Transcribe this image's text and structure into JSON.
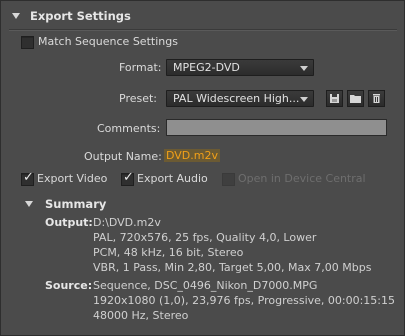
{
  "section": {
    "title": "Export Settings"
  },
  "match_sequence": {
    "label": "Match Sequence Settings",
    "checked": false
  },
  "format": {
    "label": "Format:",
    "value": "MPEG2-DVD"
  },
  "preset": {
    "label": "Preset:",
    "value": "PAL Widescreen High..."
  },
  "comments": {
    "label": "Comments:",
    "value": ""
  },
  "output_name": {
    "label": "Output Name:",
    "value": "DVD.m2v"
  },
  "export_video": {
    "label": "Export Video",
    "checked": true
  },
  "export_audio": {
    "label": "Export Audio",
    "checked": true
  },
  "device_central": {
    "label": "Open in Device Central",
    "checked": false
  },
  "summary": {
    "title": "Summary",
    "output_key": "Output:",
    "output_lines": [
      "D:\\DVD.m2v",
      "PAL, 720x576, 25 fps, Quality 4,0, Lower",
      "PCM, 48 kHz, 16 bit, Stereo",
      "VBR, 1 Pass, Min 2,80, Target 5,00, Max 7,00 Mbps"
    ],
    "source_key": "Source:",
    "source_lines": [
      "Sequence, DSC_0496_Nikon_D7000.MPG",
      "1920x1080 (1,0), 23,976 fps, Progressive, 00:00:15:15",
      "48000 Hz, Stereo"
    ]
  },
  "icons": {
    "save_preset": "save-icon",
    "import_preset": "folder-icon",
    "delete_preset": "trash-icon"
  }
}
